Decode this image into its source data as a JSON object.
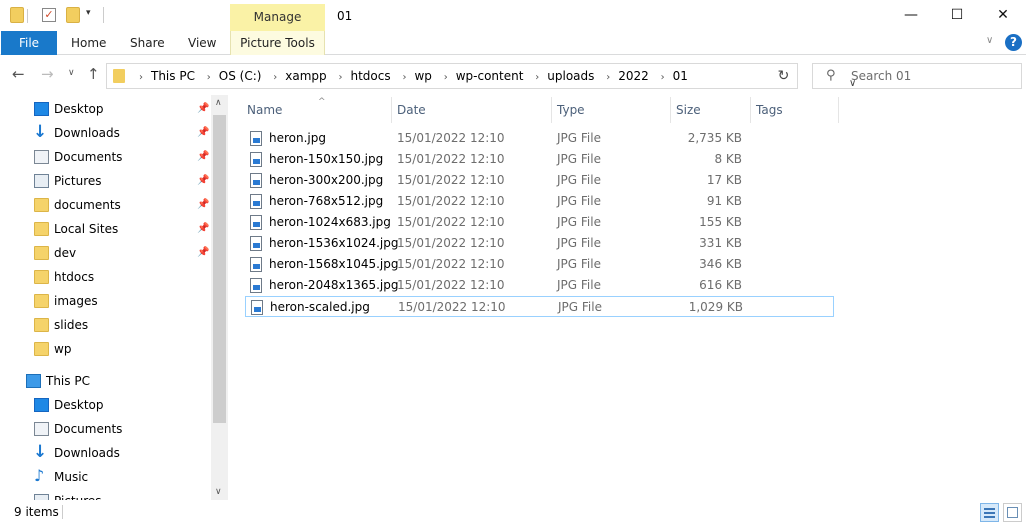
{
  "titlebar": {
    "title": "01",
    "manage_label": "Manage",
    "minimize_glyph": "—",
    "maximize_glyph": "☐",
    "close_glyph": "✕"
  },
  "ribbon": {
    "tabs": [
      {
        "label": "File"
      },
      {
        "label": "Home"
      },
      {
        "label": "Share"
      },
      {
        "label": "View"
      },
      {
        "label": "Picture Tools"
      }
    ],
    "help_glyph": "?"
  },
  "address": {
    "crumbs": [
      "This PC",
      "OS (C:)",
      "xampp",
      "htdocs",
      "wp",
      "wp-content",
      "uploads",
      "2022",
      "01"
    ],
    "search_placeholder": "Search 01"
  },
  "nav": {
    "quick_access": [
      {
        "label": "Desktop",
        "icon": "desktop-icon",
        "pinned": true
      },
      {
        "label": "Downloads",
        "icon": "downloads-icon",
        "pinned": true
      },
      {
        "label": "Documents",
        "icon": "documents-icon",
        "pinned": true
      },
      {
        "label": "Pictures",
        "icon": "pictures-icon",
        "pinned": true
      },
      {
        "label": "documents",
        "icon": "folder-icon",
        "pinned": true
      },
      {
        "label": "Local Sites",
        "icon": "folder-icon",
        "pinned": true
      },
      {
        "label": "dev",
        "icon": "folder-icon",
        "pinned": true
      },
      {
        "label": "htdocs",
        "icon": "folder-icon",
        "pinned": false
      },
      {
        "label": "images",
        "icon": "folder-icon",
        "pinned": false
      },
      {
        "label": "slides",
        "icon": "folder-icon",
        "pinned": false
      },
      {
        "label": "wp",
        "icon": "folder-icon",
        "pinned": false
      }
    ],
    "this_pc_label": "This PC",
    "this_pc_items": [
      {
        "label": "Desktop",
        "icon": "desktop-icon"
      },
      {
        "label": "Documents",
        "icon": "documents-icon"
      },
      {
        "label": "Downloads",
        "icon": "downloads-icon"
      },
      {
        "label": "Music",
        "icon": "music-icon"
      },
      {
        "label": "Pictures",
        "icon": "pictures-icon"
      }
    ]
  },
  "columns": {
    "name": "Name",
    "date": "Date",
    "type": "Type",
    "size": "Size",
    "tags": "Tags"
  },
  "files": [
    {
      "name": "heron.jpg",
      "date": "15/01/2022 12:10",
      "type": "JPG File",
      "size": "2,735 KB"
    },
    {
      "name": "heron-150x150.jpg",
      "date": "15/01/2022 12:10",
      "type": "JPG File",
      "size": "8 KB"
    },
    {
      "name": "heron-300x200.jpg",
      "date": "15/01/2022 12:10",
      "type": "JPG File",
      "size": "17 KB"
    },
    {
      "name": "heron-768x512.jpg",
      "date": "15/01/2022 12:10",
      "type": "JPG File",
      "size": "91 KB"
    },
    {
      "name": "heron-1024x683.jpg",
      "date": "15/01/2022 12:10",
      "type": "JPG File",
      "size": "155 KB"
    },
    {
      "name": "heron-1536x1024.jpg",
      "date": "15/01/2022 12:10",
      "type": "JPG File",
      "size": "331 KB"
    },
    {
      "name": "heron-1568x1045.jpg",
      "date": "15/01/2022 12:10",
      "type": "JPG File",
      "size": "346 KB"
    },
    {
      "name": "heron-2048x1365.jpg",
      "date": "15/01/2022 12:10",
      "type": "JPG File",
      "size": "616 KB"
    },
    {
      "name": "heron-scaled.jpg",
      "date": "15/01/2022 12:10",
      "type": "JPG File",
      "size": "1,029 KB",
      "selected": true
    }
  ],
  "status": {
    "count_text": "9 items"
  },
  "colors": {
    "file_tab": "#1979ca",
    "manage_tab": "#faf2a6",
    "selection_border": "#99d1ff"
  }
}
